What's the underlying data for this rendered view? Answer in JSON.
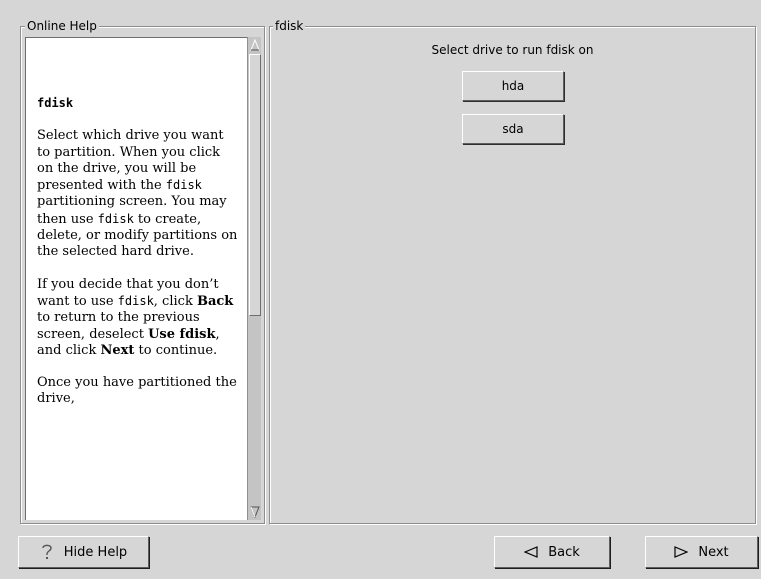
{
  "help_panel": {
    "title": "Online Help",
    "heading": "fdisk",
    "p1": {
      "t1": "Select which drive you want to partition. When you click on the drive, you will be presented with the ",
      "c1": "fdisk",
      "t2": " partitioning screen. You may then use ",
      "c2": "fdisk",
      "t3": " to create, delete, or modify partitions on the selected hard drive."
    },
    "p2": {
      "t1": "If you decide that you don’t want to use ",
      "c1": "fdisk",
      "t2": ", click ",
      "b1": "Back",
      "t3": " to return to the previous screen, deselect ",
      "b2": "Use fdisk",
      "t4": ", and click ",
      "b3": "Next",
      "t5": " to continue."
    },
    "p3": "Once you have partitioned the drive,"
  },
  "fdisk_panel": {
    "title": "fdisk",
    "prompt": "Select drive to run fdisk on",
    "drives": [
      "hda",
      "sda"
    ]
  },
  "buttons": {
    "hide_help": "Hide Help",
    "back": "Back",
    "next": "Next"
  },
  "icons": {
    "hide_help": "question-mark-icon",
    "back": "left-triangle-icon",
    "next": "right-triangle-icon"
  }
}
